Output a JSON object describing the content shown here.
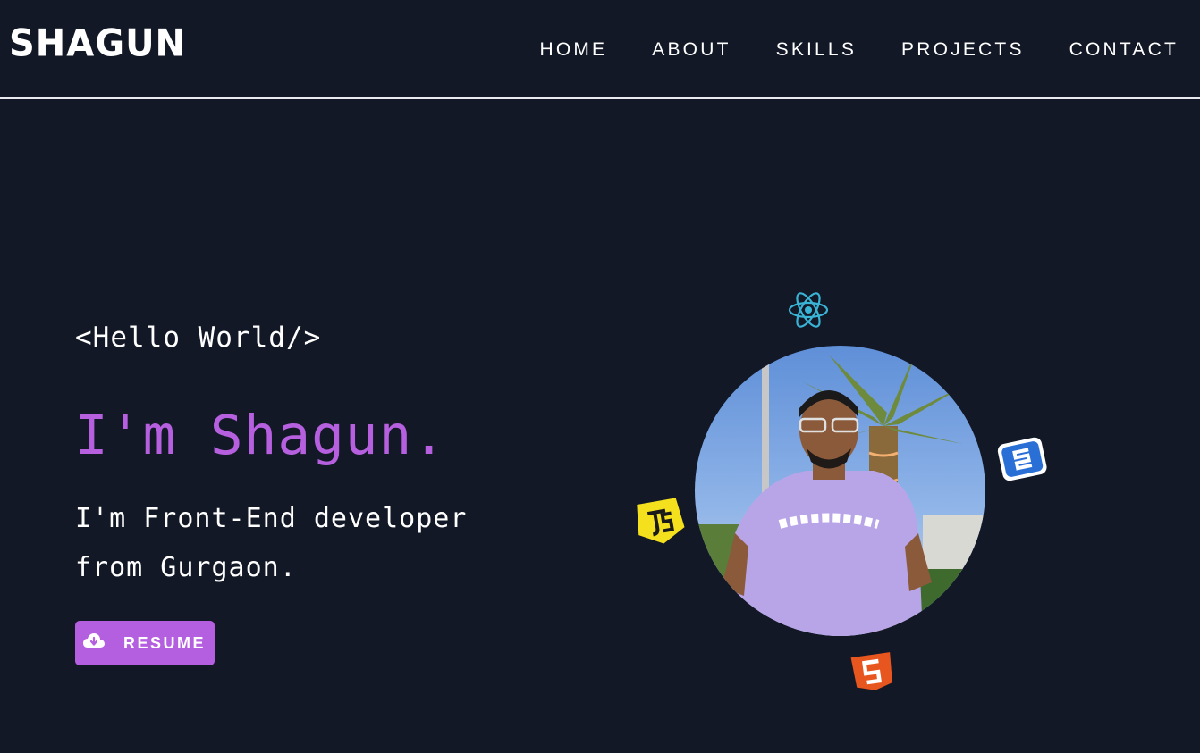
{
  "header": {
    "logo": "SHAGUN",
    "nav": [
      {
        "label": "HOME"
      },
      {
        "label": "ABOUT"
      },
      {
        "label": "SKILLS"
      },
      {
        "label": "PROJECTS"
      },
      {
        "label": "CONTACT"
      }
    ]
  },
  "hero": {
    "greeting": "<Hello World/>",
    "name": "I'm Shagun.",
    "tagline": "I'm Front-End developer from Gurgaon.",
    "resume_label": "RESUME",
    "resume_icon": "cloud-download-icon"
  },
  "profile": {
    "photo": "profile-photo",
    "orbit_icons": [
      "react-icon",
      "css3-icon",
      "javascript-icon",
      "html5-icon"
    ]
  },
  "colors": {
    "background": "#121826",
    "accent": "#b45ee0",
    "name_color": "#b660e0",
    "react": "#3ab4d6",
    "css": "#2a6fd6",
    "js": "#f5e01e",
    "html": "#e8561f"
  }
}
